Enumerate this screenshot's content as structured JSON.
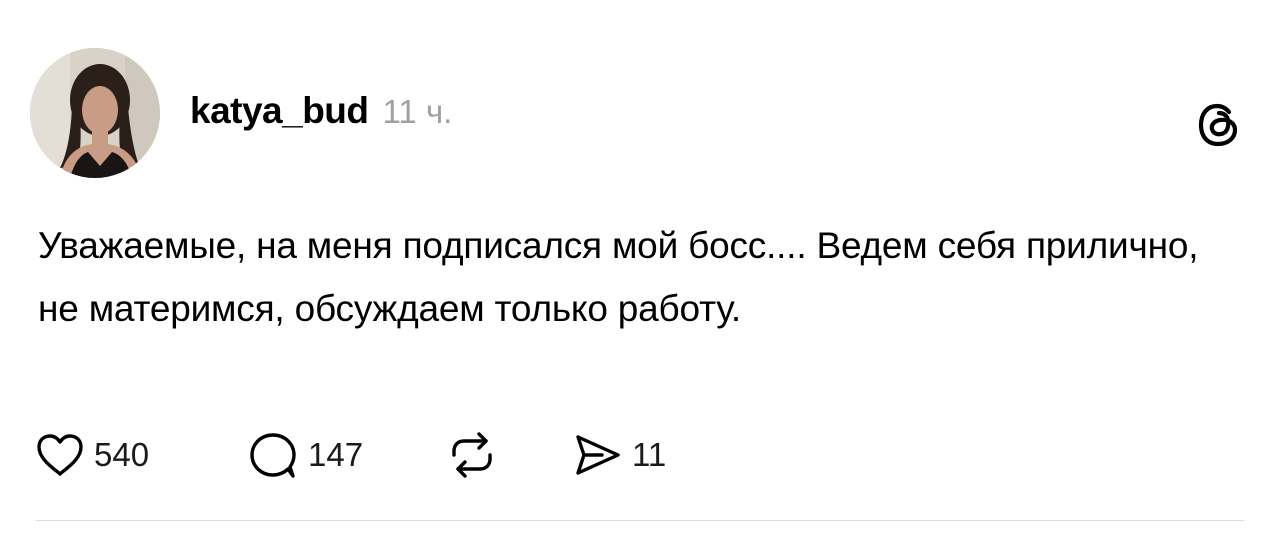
{
  "post": {
    "author": {
      "username": "katya_bud",
      "time_ago": "11 ч."
    },
    "text": "Уважаемые, на меня подписался мой босс.... Ведем себя прилично, не материмся, обсуждаем только работу.",
    "actions": {
      "likes_count": "540",
      "comments_count": "147",
      "shares_count": "11"
    }
  },
  "icons": {
    "logo": "threads-logo-icon",
    "like": "heart-icon",
    "comment": "speech-bubble-icon",
    "repost": "repost-icon",
    "share": "send-icon"
  }
}
